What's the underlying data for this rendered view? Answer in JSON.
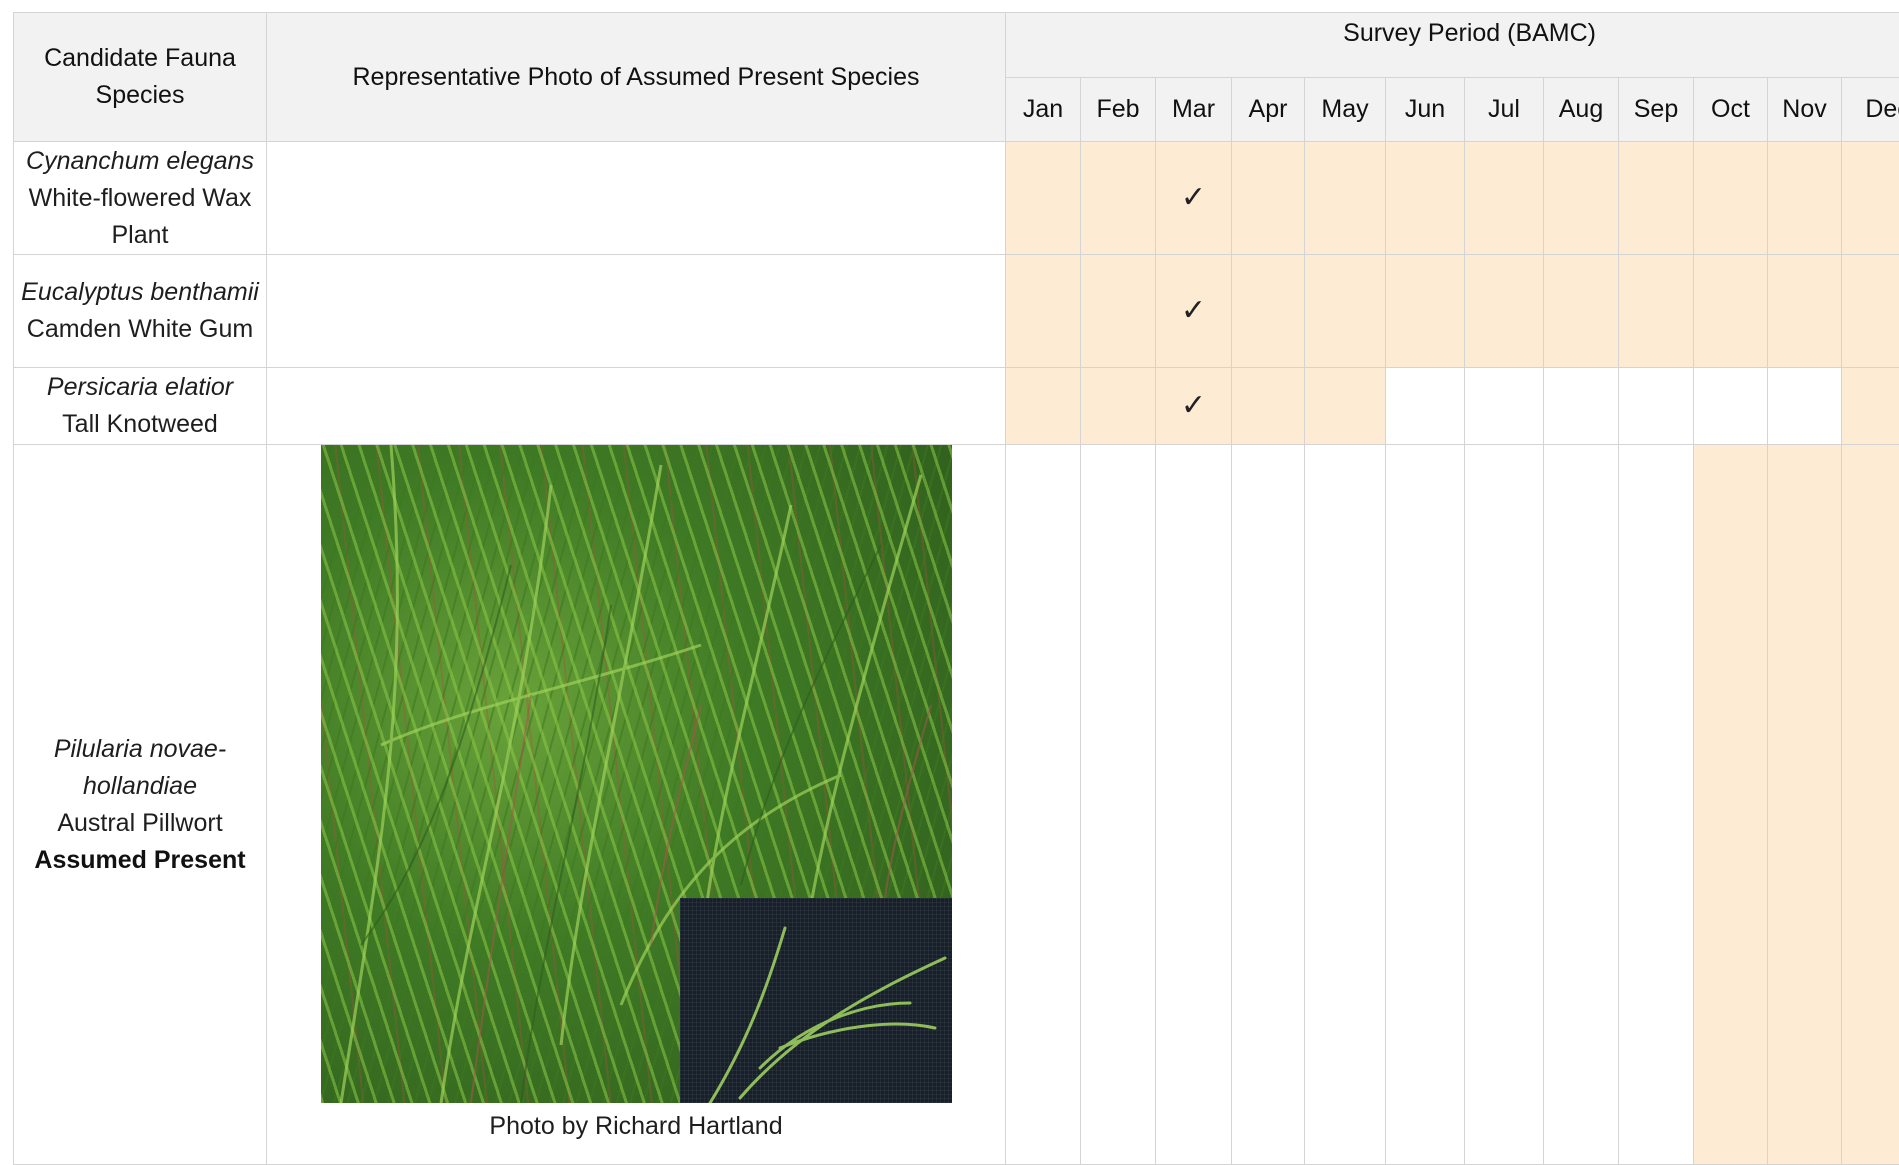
{
  "header": {
    "col_species": "Candidate Fauna Species",
    "col_photo": "Representative Photo of Assumed Present Species",
    "col_period": "Survey Period (BAMC)",
    "months": [
      "Jan",
      "Feb",
      "Mar",
      "Apr",
      "May",
      "Jun",
      "Jul",
      "Aug",
      "Sep",
      "Oct",
      "Nov",
      "Dec"
    ]
  },
  "rows": [
    {
      "scientific": "Cynanchum elegans",
      "common": "White-flowered Wax Plant",
      "status": "",
      "survey_months": [
        "Jan",
        "Feb",
        "Mar",
        "Apr",
        "May",
        "Jun",
        "Jul",
        "Aug",
        "Sep",
        "Oct",
        "Nov",
        "Dec"
      ],
      "checked_month": "Mar",
      "tick": "✓"
    },
    {
      "scientific": "Eucalyptus benthamii",
      "common": "Camden White Gum",
      "status": "",
      "survey_months": [
        "Jan",
        "Feb",
        "Mar",
        "Apr",
        "May",
        "Jun",
        "Jul",
        "Aug",
        "Sep",
        "Oct",
        "Nov",
        "Dec"
      ],
      "checked_month": "Mar",
      "tick": "✓"
    },
    {
      "scientific": "Persicaria elatior",
      "common": "Tall Knotweed",
      "status": "",
      "survey_months": [
        "Jan",
        "Feb",
        "Mar",
        "Apr",
        "May",
        "Dec"
      ],
      "checked_month": "Mar",
      "tick": "✓"
    },
    {
      "scientific": "Pilularia novae-hollandiae",
      "common": "Austral Pillwort",
      "status": "Assumed Present",
      "survey_months": [
        "Oct",
        "Nov",
        "Dec"
      ],
      "checked_month": "",
      "tick": "",
      "photo_caption": "Photo by Richard Hartland"
    }
  ],
  "colors": {
    "survey_highlight": "#fdebd3",
    "header_bg": "#f2f2f2",
    "grid": "#d4d4d4"
  }
}
